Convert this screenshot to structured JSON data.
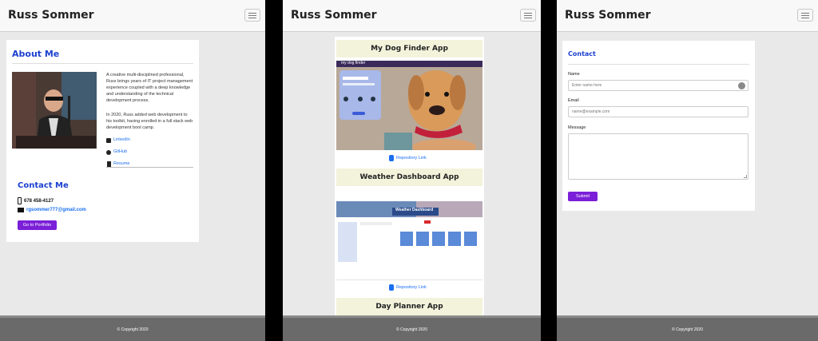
{
  "brand": "Russ Sommer",
  "footer_text": "© Copyright 2020",
  "colors": {
    "accent_button": "#7b1fd8",
    "heading_blue": "#1b3fd0",
    "link_blue": "#1a6ff0",
    "title_bar": "#f3f3dc"
  },
  "about": {
    "heading": "About Me",
    "paragraph1": "A creative multi-disciplined professional, Russ brings years of IT project management experience coupled with a deep knowledge and understanding of the technical development process.",
    "paragraph2": "In 2020, Russ added web development to his toolkit, having enrolled in a full stack web development boot camp.",
    "links": [
      "LinkedIn",
      "GitHub",
      "Resume"
    ]
  },
  "contact_me": {
    "heading": "Contact Me",
    "phone": "678 458-4127",
    "email": "rgsommer777@gmail.com",
    "portfolio_button": "Go to Portfolio"
  },
  "portfolio": {
    "apps": [
      {
        "title": "My Dog Finder App",
        "repo_link": "Repository Link",
        "screenshot_logo": "my dog finder"
      },
      {
        "title": "Weather Dashboard App",
        "repo_link": "Repository Link",
        "screenshot_header": "Weather Dashboard"
      },
      {
        "title": "Day Planner App"
      }
    ]
  },
  "contact_form": {
    "heading": "Contact",
    "name_label": "Name",
    "name_placeholder": "Enter name here",
    "email_label": "Email",
    "email_placeholder": "name@example.com",
    "message_label": "Message",
    "submit": "Submit"
  }
}
